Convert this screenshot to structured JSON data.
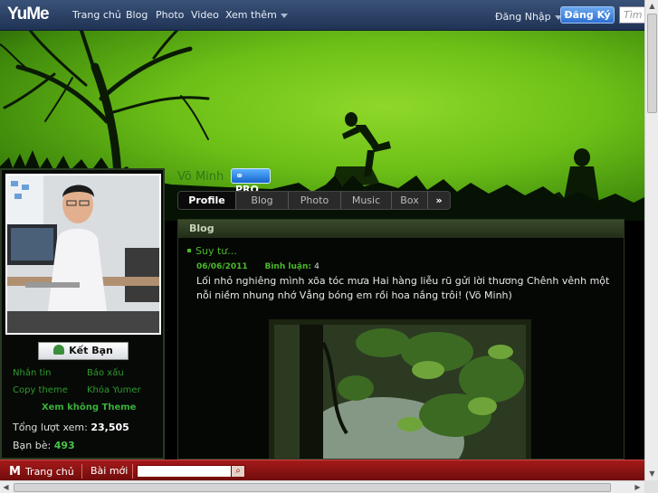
{
  "topbar": {
    "logo": "YuMe",
    "nav": [
      "Trang chủ",
      "Blog",
      "Photo",
      "Video",
      "Xem thêm"
    ],
    "login": "Đăng Nhập",
    "register": "Đăng Ký",
    "search_placeholder": "Tìm k"
  },
  "profile": {
    "name": "Võ Minh",
    "pro_badge": "PRO",
    "add_friend": "Kết Bạn",
    "links": [
      "Nhắn tin",
      "Báo xấu",
      "Copy theme",
      "Khóa Yumer"
    ],
    "no_theme": "Xem không Theme",
    "views_label": "Tổng lượt xem:",
    "views_value": "23,505",
    "friends_label": "Bạn bè:",
    "friends_value": "493"
  },
  "tabs": [
    "Profile",
    "Blog",
    "Photo",
    "Music",
    "Box"
  ],
  "content": {
    "section_title": "Blog",
    "post_title": "Suy tư...",
    "post_date": "06/06/2011",
    "comments_label": "Bình luận:",
    "comments_value": "4",
    "post_body": "Lối nhỏ nghiêng mình xõa tóc mưa Hai hàng liễu rũ gửi lời thương Chênh vênh một nỗi niềm nhung nhớ Vẳng bóng em rồi hoa nắng trôi! (Võ Minh)"
  },
  "bottombar": {
    "home": "Trang chủ",
    "new_posts": "Bài mới"
  },
  "colors": {
    "topbar": "#2c4266",
    "accent_green": "#4ab82a",
    "bottombar": "#8e1414",
    "register_blue": "#2f6fd2"
  }
}
